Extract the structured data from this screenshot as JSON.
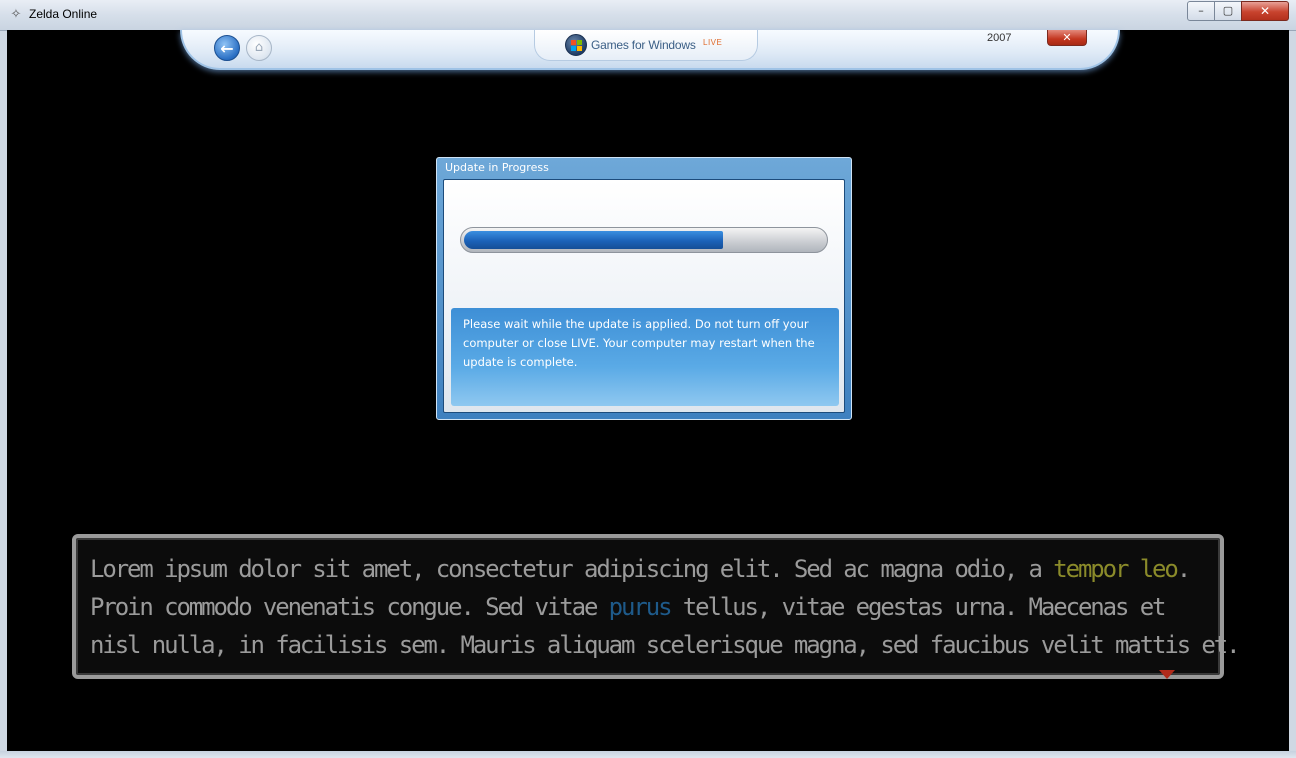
{
  "window": {
    "title": "Zelda Online",
    "app_icon": "zelda-app-icon",
    "minimize_glyph": "–",
    "maximize_glyph": "▢",
    "close_glyph": "✕"
  },
  "gfw_bar": {
    "back_icon": "back-arrow-icon",
    "home_icon": "home-icon",
    "brand": "Games for Windows",
    "brand_suffix": "LIVE",
    "year": "2007",
    "close_glyph": "✕"
  },
  "dialog": {
    "title": "Update in Progress",
    "progress": 0.72,
    "progress_color": "#1c62b8",
    "message": "Please wait while the update is applied. Do not turn off your computer or close LIVE. Your computer may restart when the update is complete."
  },
  "message_box": {
    "line1_a": "Lorem ipsum dolor sit amet, consectetur adipiscing elit. Sed ac magna odio, a ",
    "line1_hl": "tempor leo",
    "line1_b": ".",
    "line2_a": "Proin commodo venenatis congue. Sed vitae ",
    "line2_hl": "purus",
    "line2_b": " tellus, vitae egestas urna. Maecenas et",
    "line3": "nisl nulla, in facilisis sem. Mauris aliquam scelerisque magna, sed faucibus velit mattis et.",
    "next_icon": "next-page-arrow-icon",
    "highlight_colors": {
      "yellow": "#8b8b2a",
      "blue": "#1e5a8a"
    }
  }
}
